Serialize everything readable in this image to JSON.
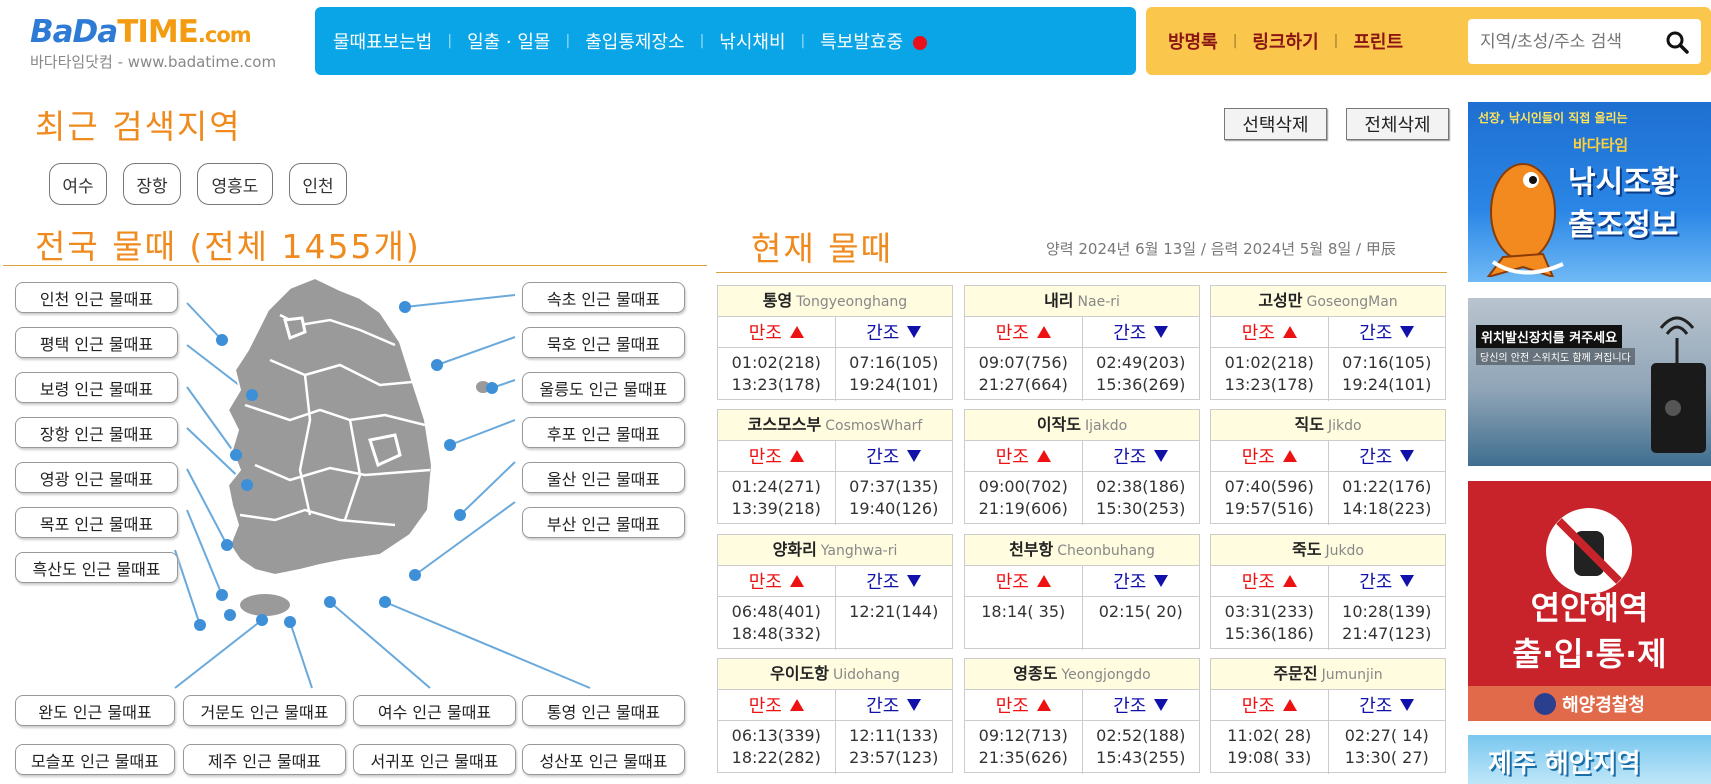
{
  "logo": {
    "part1": "BaDa",
    "part2": "TIME",
    "part3": ".com",
    "subtitle": "바다타임닷컴 - www.badatime.com"
  },
  "nav_blue": [
    {
      "label": "물때표보는법"
    },
    {
      "label": "일출 · 일몰"
    },
    {
      "label": "출입통제장소"
    },
    {
      "label": "낚시채비"
    },
    {
      "label": "특보발효중"
    }
  ],
  "nav_yellow": [
    {
      "label": "방명록"
    },
    {
      "label": "링크하기"
    },
    {
      "label": "프린트"
    }
  ],
  "search": {
    "placeholder": "지역/초성/주소 검색"
  },
  "recent": {
    "title": "최근 검색지역",
    "delete_selected": "선택삭제",
    "delete_all": "전체삭제",
    "chips": [
      "여수",
      "장항",
      "영흥도",
      "인천"
    ]
  },
  "national": {
    "title": "전국 물때 (전체 1455개)"
  },
  "map_buttons": {
    "left": [
      "인천 인근 물때표",
      "평택 인근 물때표",
      "보령 인근 물때표",
      "장항 인근 물때표",
      "영광 인근 물때표",
      "목포 인근 물때표",
      "흑산도 인근 물때표"
    ],
    "right": [
      "속초 인근 물때표",
      "묵호 인근 물때표",
      "울릉도 인근 물때표",
      "후포 인근 물때표",
      "울산 인근 물때표",
      "부산 인근 물때표"
    ],
    "bottom1": [
      "완도 인근 물때표",
      "거문도 인근 물때표",
      "여수 인근 물때표",
      "통영 인근 물때표"
    ],
    "bottom2": [
      "모슬포 인근 물때표",
      "제주 인근 물때표",
      "서귀포 인근 물때표",
      "성산포 인근 물때표"
    ]
  },
  "current": {
    "title": "현재 물때",
    "date": "양력 2024년 6월 13일 / 음력 2024년 5월 8일 / 甲辰",
    "high_label": "만조",
    "low_label": "간조"
  },
  "tides": [
    {
      "kr": "통영",
      "en": "Tongyeonghang",
      "high": "01:02(218)\n13:23(178)",
      "low": "07:16(105)\n19:24(101)"
    },
    {
      "kr": "내리",
      "en": "Nae-ri",
      "high": "09:07(756)\n21:27(664)",
      "low": "02:49(203)\n15:36(269)"
    },
    {
      "kr": "고성만",
      "en": "GoseongMan",
      "high": "01:02(218)\n13:23(178)",
      "low": "07:16(105)\n19:24(101)"
    },
    {
      "kr": "코스모스부",
      "en": "CosmosWharf",
      "high": "01:24(271)\n13:39(218)",
      "low": "07:37(135)\n19:40(126)"
    },
    {
      "kr": "이작도",
      "en": "Ijakdo",
      "high": "09:00(702)\n21:19(606)",
      "low": "02:38(186)\n15:30(253)"
    },
    {
      "kr": "직도",
      "en": "Jikdo",
      "high": "07:40(596)\n19:57(516)",
      "low": "01:22(176)\n14:18(223)"
    },
    {
      "kr": "양화리",
      "en": "Yanghwa-ri",
      "high": "06:48(401)\n18:48(332)",
      "low": "12:21(144)"
    },
    {
      "kr": "천부항",
      "en": "Cheonbuhang",
      "high": "18:14( 35)",
      "low": "02:15( 20)"
    },
    {
      "kr": "죽도",
      "en": "Jukdo",
      "high": "03:31(233)\n15:36(186)",
      "low": "10:28(139)\n21:47(123)"
    },
    {
      "kr": "우이도항",
      "en": "Uidohang",
      "high": "06:13(339)\n18:22(282)",
      "low": "12:11(133)\n23:57(123)"
    },
    {
      "kr": "영종도",
      "en": "Yeongjongdo",
      "high": "09:12(713)\n21:35(626)",
      "low": "02:52(188)\n15:43(255)"
    },
    {
      "kr": "주문진",
      "en": "Jumunjin",
      "high": "11:02( 28)\n19:08( 33)",
      "low": "02:27( 14)\n13:30( 27)"
    }
  ],
  "ads": {
    "ad1_top": "선장, 낚시인들이 직접 올리는",
    "ad1_brand": "바다타임",
    "ad1_main1": "낚시조황",
    "ad1_main2": "출조정보",
    "ad2_top": "위치발신장치를 켜주세요",
    "ad2_sub": "당신의 안전 스위치도 함께 켜집니다",
    "ad3_line1": "연안해역",
    "ad3_line2": "출·입·통·제",
    "ad3_org": "해양경찰청",
    "ad4": "제주 해안지역"
  },
  "colors": {
    "nav_blue": "#0aa5e6",
    "nav_yellow": "#fbc64c",
    "heading_orange": "#ee8a1e",
    "high_red": "#e11111",
    "low_blue": "#1111aa"
  }
}
